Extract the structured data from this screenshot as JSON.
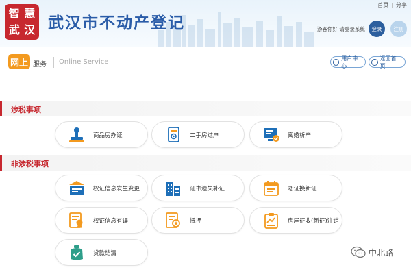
{
  "header": {
    "logo_chars": [
      "智",
      "慧",
      "武",
      "汉"
    ],
    "title": "武汉市不动产登记",
    "top_links": [
      "首页",
      "分享"
    ],
    "guest_text": "游客你好 请登录系统",
    "login_label": "登录",
    "register_label": "注册"
  },
  "service_bar": {
    "icon_char": "网上",
    "label_cn": "服务",
    "label_en": "Online Service",
    "user_center": "用户中心",
    "back_home": "返回首页"
  },
  "sections": [
    {
      "title": "涉税事项",
      "items": [
        {
          "label": "商品房办证",
          "icon": "stamp-icon"
        },
        {
          "label": "二手房过户",
          "icon": "document-transfer-icon"
        },
        {
          "label": "离婚析产",
          "icon": "screen-check-icon"
        }
      ]
    },
    {
      "title": "非涉税事项",
      "items": [
        {
          "label": "权证信息发生变更",
          "icon": "id-card-icon"
        },
        {
          "label": "证书遗失补证",
          "icon": "building-icon"
        },
        {
          "label": "老证换新证",
          "icon": "calendar-icon"
        },
        {
          "label": "权证信息有误",
          "icon": "certificate-icon"
        },
        {
          "label": "抵押",
          "icon": "document-seal-icon"
        },
        {
          "label": "房屋征收(新征)注销",
          "icon": "clipboard-icon"
        },
        {
          "label": "贷款结清",
          "icon": "bag-check-icon"
        }
      ]
    }
  ],
  "watermark": "中北路",
  "colors": {
    "brand_red": "#c7282f",
    "title_blue": "#2a5ca8",
    "accent_blue": "#2c5f9e",
    "orange": "#f39a1f",
    "icon_blue": "#1e6fb8"
  }
}
